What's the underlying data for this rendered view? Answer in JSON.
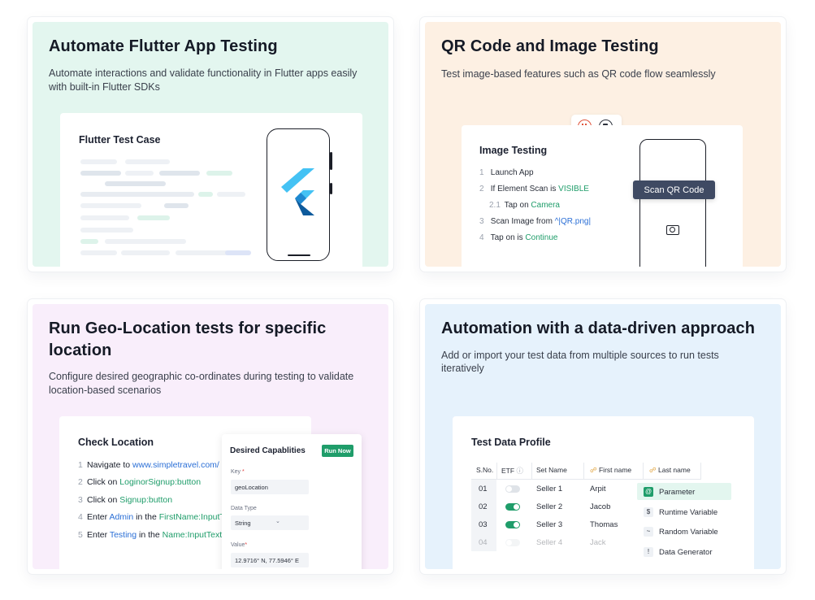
{
  "cards": {
    "flutter": {
      "title": "Automate Flutter App Testing",
      "desc_line1": "Automate interactions and validate functionality in Flutter apps easily",
      "desc_line2": "with built-in Flutter SDKs",
      "panel_title": "Flutter Test Case"
    },
    "qr": {
      "title": "QR Code and Image Testing",
      "desc": "Test image-based features such as QR code flow seamlessly",
      "panel_title": "Image Testing",
      "steps": [
        {
          "num": "1",
          "pre": "Launch App",
          "hl": "",
          "post": ""
        },
        {
          "num": "2",
          "pre": "If Element Scan is ",
          "hl": "VISIBLE",
          "post": ""
        },
        {
          "num": "2.1",
          "pre": "Tap on ",
          "hl": "Camera",
          "post": ""
        },
        {
          "num": "3",
          "pre": "Scan Image from ",
          "hl": "^|QR.png|",
          "post": ""
        },
        {
          "num": "4",
          "pre": "Tap on is ",
          "hl": "Continue",
          "post": ""
        }
      ],
      "scan_button": "Scan QR Code"
    },
    "geo": {
      "title_line1": "Run Geo-Location tests for specific",
      "title_line2": "location",
      "desc_line1": "Configure desired geographic co-ordinates during testing to validate",
      "desc_line2": "location-based scenarios",
      "panel_title": "Check Location",
      "steps": [
        {
          "num": "1",
          "pre": "Navigate to ",
          "hl": "www.simpletravel.com/",
          "mid": "",
          "hl2": ""
        },
        {
          "num": "2",
          "pre": "Click on ",
          "hl": "LoginorSignup:button",
          "mid": "",
          "hl2": ""
        },
        {
          "num": "3",
          "pre": "Click on ",
          "hl": "Signup:button",
          "mid": "",
          "hl2": ""
        },
        {
          "num": "4",
          "pre": "Enter ",
          "hl": "Admin",
          "mid": " in the ",
          "hl2": "FirstName:InputText"
        },
        {
          "num": "5",
          "pre": "Enter ",
          "hl": "Testing",
          "mid": " in the ",
          "hl2": "Name:InputText"
        }
      ],
      "caps": {
        "title": "Desired Capablities",
        "run_label": "Run Now",
        "key_label": "Key",
        "key_value": "geoLocation",
        "type_label": "Data Type",
        "type_value": "String",
        "value_label": "Value",
        "value_value": "12.9716° N, 77.5946° E"
      }
    },
    "data": {
      "title": "Automation with a data-driven approach",
      "desc_line1": "Add or import your test data from multiple sources to run tests",
      "desc_line2": "iteratively",
      "panel_title": "Test Data Profile",
      "columns": [
        "S.No.",
        "ETF",
        "Set Name",
        "First name",
        "Last name"
      ],
      "rows": [
        {
          "sno": "01",
          "on": false,
          "set": "Seller 1",
          "first": "Arpit"
        },
        {
          "sno": "02",
          "on": true,
          "set": "Seller 2",
          "first": "Jacob"
        },
        {
          "sno": "03",
          "on": true,
          "set": "Seller 3",
          "first": "Thomas"
        },
        {
          "sno": "04",
          "on": false,
          "set": "Seller 4",
          "first": "Jack"
        }
      ],
      "menu": [
        {
          "icon": "@",
          "label": "Parameter"
        },
        {
          "icon": "$",
          "label": "Runtime Variable"
        },
        {
          "icon": "~",
          "label": "Random Variable"
        },
        {
          "icon": "!",
          "label": "Data Generator"
        }
      ]
    }
  },
  "colors": {
    "green": "#1f9d6a",
    "blue": "#2b6fd6",
    "scan_bg": "#3f4a63",
    "pause_red": "#e0543b"
  }
}
